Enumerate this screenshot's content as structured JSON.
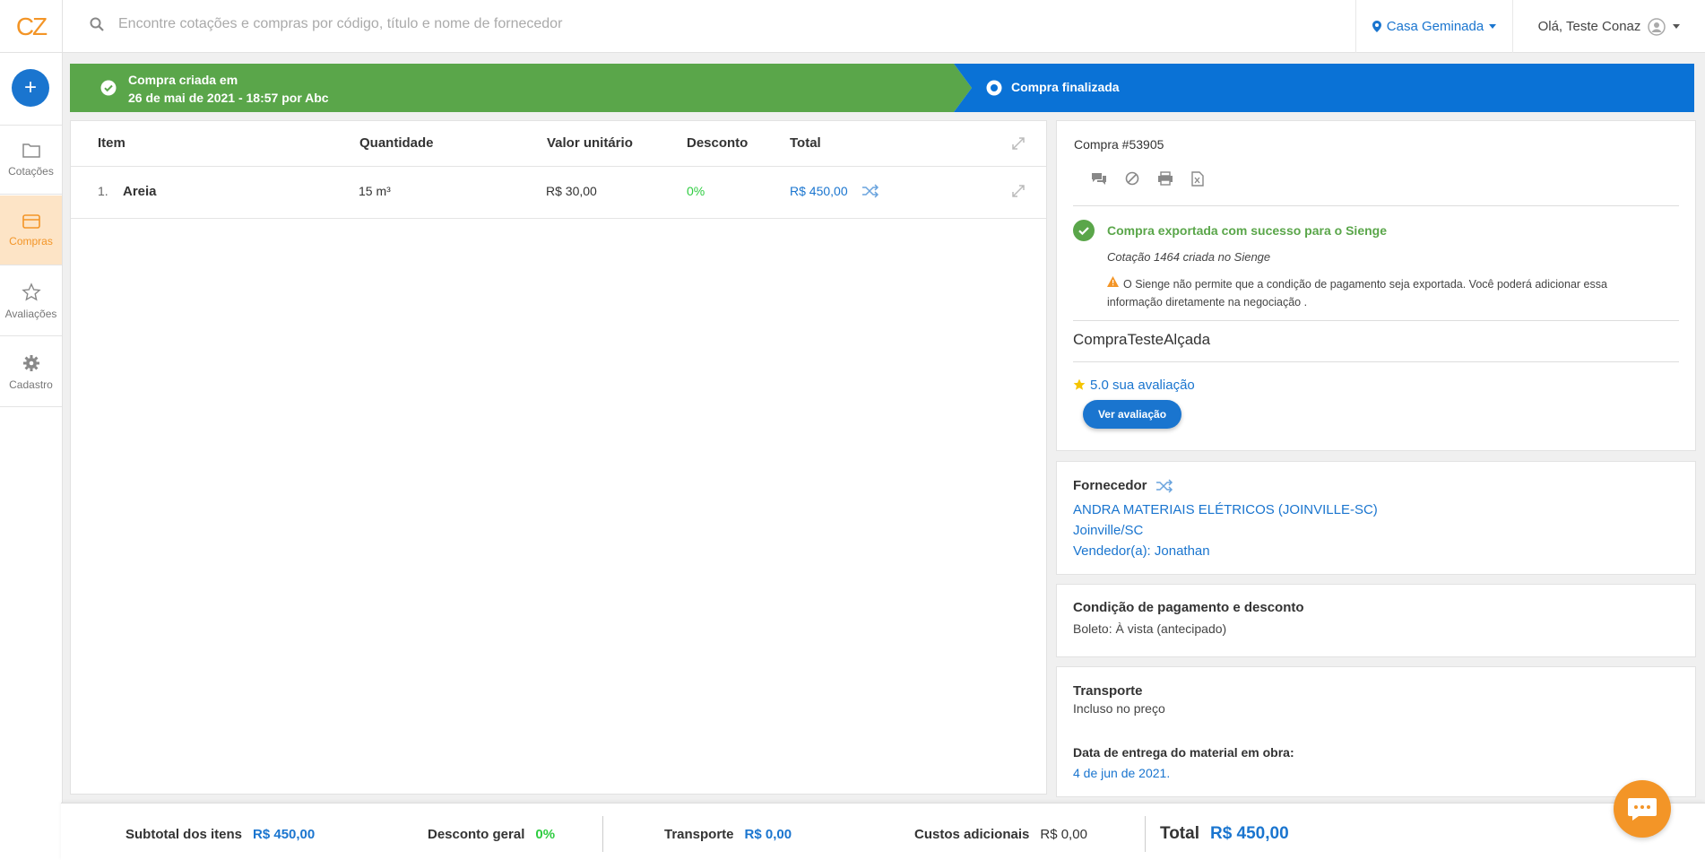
{
  "app": {
    "logo": "CZ"
  },
  "search": {
    "placeholder": "Encontre cotações e compras por código, título e nome de fornecedor"
  },
  "location": {
    "label": "Casa Geminada"
  },
  "user": {
    "greeting": "Olá, Teste Conaz"
  },
  "sidebar": {
    "add_label": "+",
    "items": [
      {
        "label": "Cotações",
        "icon": "folder-icon"
      },
      {
        "label": "Compras",
        "icon": "card-icon",
        "active": true
      },
      {
        "label": "Avaliações",
        "icon": "star-icon"
      },
      {
        "label": "Cadastro",
        "icon": "gear-icon"
      }
    ]
  },
  "status": {
    "created_line1": "Compra criada em",
    "created_line2": "26 de mai de 2021 - 18:57 por Abc",
    "finalized": "Compra finalizada"
  },
  "table": {
    "headers": [
      "Item",
      "Quantidade",
      "Valor unitário",
      "Desconto",
      "Total"
    ],
    "rows": [
      {
        "num": "1.",
        "item": "Areia",
        "quantity": "15 m³",
        "unit_price": "R$ 30,00",
        "discount": "0%",
        "total": "R$ 450,00"
      }
    ]
  },
  "purchase": {
    "title": "Compra #53905",
    "export_success": "Compra exportada com sucesso para o Sienge",
    "quote_note": "Cotação 1464 criada no Sienge",
    "warning": "O Sienge não permite que a condição de pagamento seja exportada. Você poderá adicionar essa informação diretamente na negociação .",
    "name": "CompraTesteAlçada",
    "rating": "5.0 sua avaliação",
    "view_rating": "Ver avaliação"
  },
  "supplier": {
    "label": "Fornecedor",
    "name": "ANDRA MATERIAIS ELÉTRICOS (JOINVILLE-SC)",
    "city": "Joinville/SC",
    "seller": "Vendedor(a): Jonathan"
  },
  "payment": {
    "label": "Condição de pagamento e desconto",
    "value": "Boleto: À vista (antecipado)"
  },
  "transport": {
    "label": "Transporte",
    "value": "Incluso no preço",
    "delivery_label": "Data de entrega do material em obra:",
    "delivery_date": "4 de jun de 2021."
  },
  "footer": {
    "subtotal_label": "Subtotal dos itens",
    "subtotal": "R$ 450,00",
    "discount_label": "Desconto geral",
    "discount": "0%",
    "transport_label": "Transporte",
    "transport": "R$ 0,00",
    "extra_label": "Custos adicionais",
    "extra": "R$ 0,00",
    "total_label": "Total",
    "total": "R$ 450,00"
  },
  "colors": {
    "accent": "#1a75cf",
    "brand": "#f39527",
    "success": "#5aa64a",
    "discount": "#2ecc40"
  }
}
